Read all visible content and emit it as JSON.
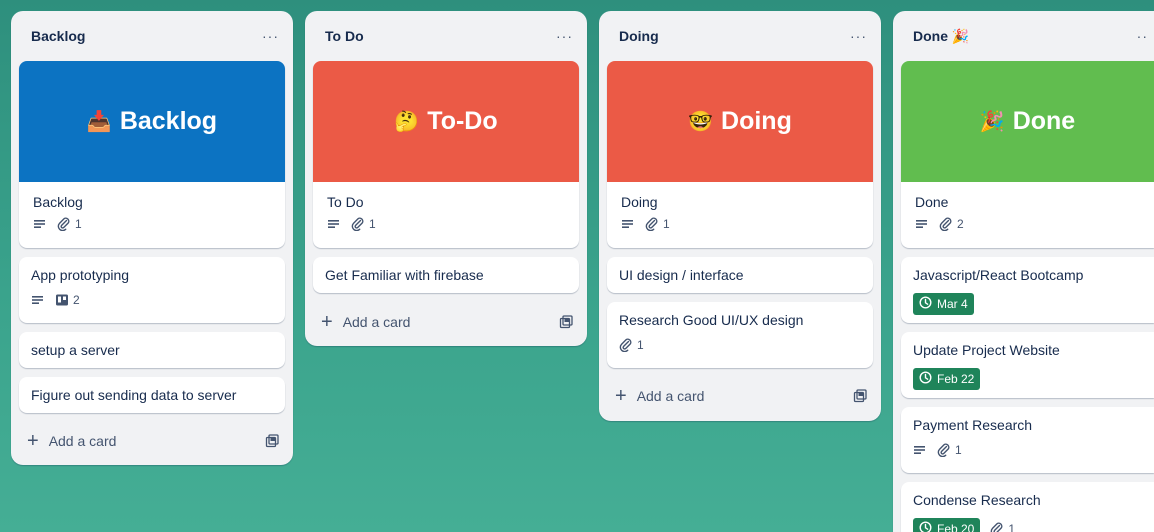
{
  "lists": [
    {
      "title": "Backlog",
      "menu": "···",
      "cover": {
        "emoji": "📥",
        "text": "Backlog",
        "color": "#0c73c2"
      },
      "cover_card": {
        "title": "Backlog",
        "attachments": "1"
      },
      "cards": [
        {
          "title": "App prototyping",
          "checklist": "2"
        },
        {
          "title": "setup a server"
        },
        {
          "title": "Figure out sending data to server"
        }
      ],
      "add_label": "Add a card"
    },
    {
      "title": "To Do",
      "menu": "···",
      "cover": {
        "emoji": "🤔",
        "text": "To-Do",
        "color": "#eb5a46"
      },
      "cover_card": {
        "title": "To Do",
        "attachments": "1"
      },
      "cards": [
        {
          "title": "Get Familiar with firebase"
        }
      ],
      "add_label": "Add a card"
    },
    {
      "title": "Doing",
      "menu": "···",
      "cover": {
        "emoji": "🤓",
        "text": "Doing",
        "color": "#eb5a46"
      },
      "cover_card": {
        "title": "Doing",
        "attachments": "1"
      },
      "cards": [
        {
          "title": "UI design / interface"
        },
        {
          "title": "Research Good UI/UX design",
          "attachments": "1"
        }
      ],
      "add_label": "Add a card"
    },
    {
      "title": "Done 🎉",
      "menu": "··",
      "cover": {
        "emoji": "🎉",
        "text": "Done",
        "color": "#61bd4f"
      },
      "cover_card": {
        "title": "Done",
        "attachments": "2"
      },
      "cards": [
        {
          "title": "Javascript/React Bootcamp",
          "due": "Mar 4"
        },
        {
          "title": "Update Project Website",
          "due": "Feb 22"
        },
        {
          "title": "Payment Research",
          "attachments": "1"
        },
        {
          "title": "Condense Research",
          "due": "Feb 20",
          "attachments": "1"
        }
      ]
    }
  ],
  "colors": {
    "due_green": "#1f845a",
    "list_bg": "#f1f2f4",
    "text": "#172b4d",
    "muted": "#44546f"
  }
}
